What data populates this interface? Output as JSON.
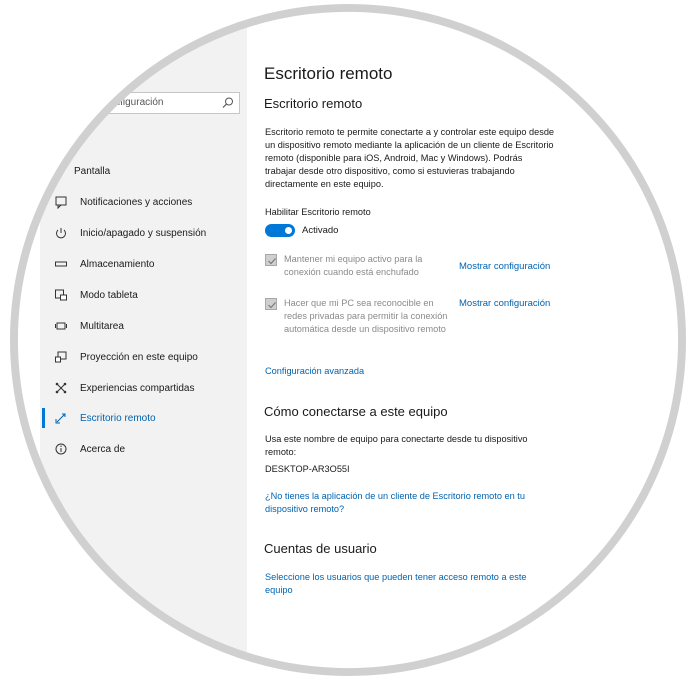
{
  "sidebar": {
    "search_placeholder": "onfiguración",
    "partial_label": "a",
    "items": [
      {
        "label": "Pantalla",
        "icon": "display-icon"
      },
      {
        "label": "Notificaciones y acciones",
        "icon": "notifications-icon"
      },
      {
        "label": "Inicio/apagado y suspensión",
        "icon": "power-icon"
      },
      {
        "label": "Almacenamiento",
        "icon": "storage-icon"
      },
      {
        "label": "Modo tableta",
        "icon": "tablet-mode-icon"
      },
      {
        "label": "Multitarea",
        "icon": "multitasking-icon"
      },
      {
        "label": "Proyección en este equipo",
        "icon": "projection-icon"
      },
      {
        "label": "Experiencias compartidas",
        "icon": "shared-experiences-icon"
      },
      {
        "label": "Escritorio remoto",
        "icon": "remote-desktop-icon"
      },
      {
        "label": "Acerca de",
        "icon": "info-icon"
      }
    ],
    "active_item": "Escritorio remoto"
  },
  "main": {
    "page_title": "Escritorio remoto",
    "section_title": "Escritorio remoto",
    "description": "Escritorio remoto te permite conectarte a y controlar este equipo desde un dispositivo remoto mediante la aplicación de un cliente de Escritorio remoto (disponible para iOS, Android, Mac y Windows). Podrás trabajar desde otro dispositivo, como si estuvieras trabajando directamente en este equipo.",
    "enable_label": "Habilitar Escritorio remoto",
    "toggle_state": "Activado",
    "option1_text": "Mantener mi equipo activo para la conexión cuando está enchufado",
    "option1_link": "Mostrar configuración",
    "option2_text": "Hacer que mi PC sea reconocible en redes privadas para permitir la conexión automática desde un dispositivo remoto",
    "option2_link": "Mostrar configuración",
    "advanced_link": "Configuración avanzada",
    "connect_title": "Cómo conectarse a este equipo",
    "connect_desc": "Usa este nombre de equipo para conectarte desde tu dispositivo remoto:",
    "pc_name": "DESKTOP-AR3O55I",
    "client_link": "¿No tienes la aplicación de un cliente de Escritorio remoto en tu dispositivo remoto?",
    "accounts_title": "Cuentas de usuario",
    "accounts_link": "Seleccione los usuarios que pueden tener acceso remoto a este equipo"
  },
  "colors": {
    "accent": "#0078d7",
    "link": "#0063b1",
    "sidebar_bg": "#f2f2f2",
    "ring": "#d0d0d0"
  }
}
